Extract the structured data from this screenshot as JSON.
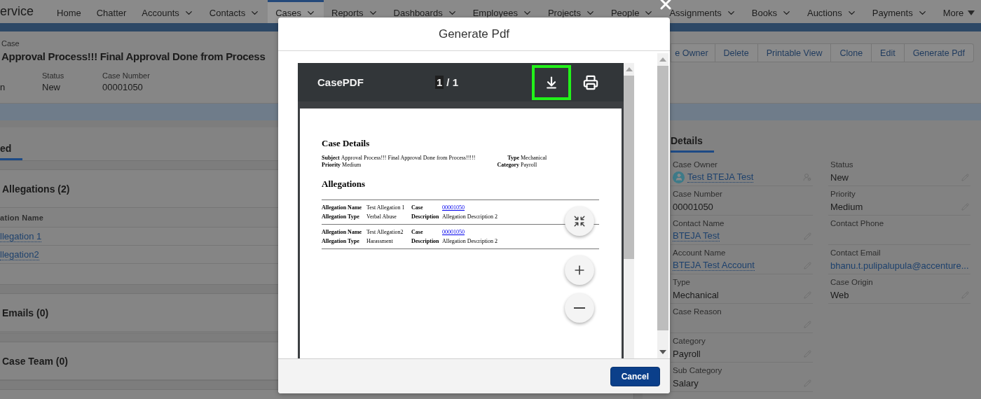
{
  "nav": {
    "app_name": "ervice",
    "items": [
      {
        "label": "Home",
        "kind": "link",
        "selected": false
      },
      {
        "label": "Chatter",
        "kind": "link",
        "selected": false
      },
      {
        "label": "Accounts",
        "kind": "menu",
        "selected": false
      },
      {
        "label": "Contacts",
        "kind": "menu",
        "selected": false
      },
      {
        "label": "Cases",
        "kind": "menu",
        "selected": true
      },
      {
        "label": "Reports",
        "kind": "menu",
        "selected": false
      },
      {
        "label": "Dashboards",
        "kind": "menu",
        "selected": false
      },
      {
        "label": "Employees",
        "kind": "menu",
        "selected": false
      },
      {
        "label": "Projects",
        "kind": "menu",
        "selected": false
      },
      {
        "label": "People",
        "kind": "menu",
        "selected": false
      },
      {
        "label": "Assignments",
        "kind": "menu",
        "selected": false
      },
      {
        "label": "Books",
        "kind": "menu",
        "selected": false
      },
      {
        "label": "Auctions",
        "kind": "menu",
        "selected": false
      },
      {
        "label": "Payments",
        "kind": "menu",
        "selected": false
      },
      {
        "label": "More",
        "kind": "more",
        "selected": false
      }
    ]
  },
  "record": {
    "object_label": "Case",
    "title": "Approval Process!!! Final Approval Done from Process",
    "actions": [
      "e Owner",
      "Delete",
      "Printable View",
      "Clone",
      "Edit",
      "Generate Pdf"
    ],
    "highlights": [
      {
        "value": "n"
      },
      {
        "label": "Status",
        "value": "New"
      },
      {
        "label": "Case Number",
        "value": "00001050"
      }
    ]
  },
  "related": {
    "tab": "ed",
    "cards": [
      {
        "title": "Allegations (2)",
        "column": "ation Name",
        "rows": [
          "llegation 1",
          "llegation2"
        ]
      },
      {
        "title": "Emails (0)"
      },
      {
        "title": "Case Team (0)"
      }
    ]
  },
  "details": {
    "tab": "Details",
    "left_fields": [
      {
        "label": "Case Owner",
        "value": "Test BTEJA Test",
        "kind": "user"
      },
      {
        "label": "Case Number",
        "value": "00001050",
        "kind": "text",
        "editable": false
      },
      {
        "label": "Contact Name",
        "value": "BTEJA Test",
        "kind": "link",
        "editable": true
      },
      {
        "label": "Account Name",
        "value": "BTEJA Test Account",
        "kind": "link",
        "editable": true
      },
      {
        "label": "Type",
        "value": "Mechanical",
        "kind": "text",
        "editable": true
      },
      {
        "label": "Case Reason",
        "kind": "text",
        "editable": true
      },
      {
        "label": "Category",
        "value": "Payroll",
        "kind": "text",
        "editable": true
      },
      {
        "label": "Sub Category",
        "value": "Salary",
        "kind": "text",
        "editable": true
      }
    ],
    "right_fields": [
      {
        "label": "Status",
        "value": "New",
        "kind": "text",
        "editable": true
      },
      {
        "label": "Priority",
        "value": "Medium",
        "kind": "text",
        "editable": true
      },
      {
        "label": "Contact Phone",
        "kind": "text",
        "editable": false
      },
      {
        "label": "Contact Email",
        "value": "bhanu.t.pulipalupula@accenture...",
        "kind": "link",
        "editable": false
      },
      {
        "label": "Case Origin",
        "value": "Web",
        "kind": "text",
        "editable": true
      }
    ]
  },
  "modal": {
    "title": "Generate Pdf",
    "viewer": {
      "document_title": "CasePDF",
      "page": "1",
      "page_count": "/ 1",
      "tools": [
        {
          "kind": "download",
          "highlighted": true
        },
        {
          "kind": "print",
          "highlighted": false
        }
      ],
      "zoom_controls": [
        {
          "kind": "fit"
        },
        {
          "kind": "zoom_in"
        },
        {
          "kind": "zoom_out"
        }
      ],
      "pdf": {
        "heading": "Case Details",
        "fields": [
          {
            "label": "Subject",
            "value": "Approval Process!!! Final Approval Done from Process!!!!!"
          },
          {
            "label": "Type",
            "value": "Mechanical"
          },
          {
            "label": "Priority",
            "value": "Medium"
          },
          {
            "label": "Category",
            "value": "Payroll"
          }
        ],
        "section": "Allegations",
        "allegations": [
          {
            "name_label": "Allegation Name",
            "name": "Test Allegation 1",
            "case_label": "Case",
            "case": "00001050",
            "type_label": "Allegation Type",
            "type": "Verbal Abuse",
            "description_label": "Description",
            "description": "Allegation Description 2"
          },
          {
            "name_label": "Allegation Name",
            "name": "Test Allegation2",
            "case_label": "Case",
            "case": "00001050",
            "type_label": "Allegation Type",
            "type": "Harassment",
            "description_label": "Description",
            "description": "Allegation Description 2"
          }
        ]
      }
    },
    "buttons": [
      "Cancel"
    ]
  }
}
